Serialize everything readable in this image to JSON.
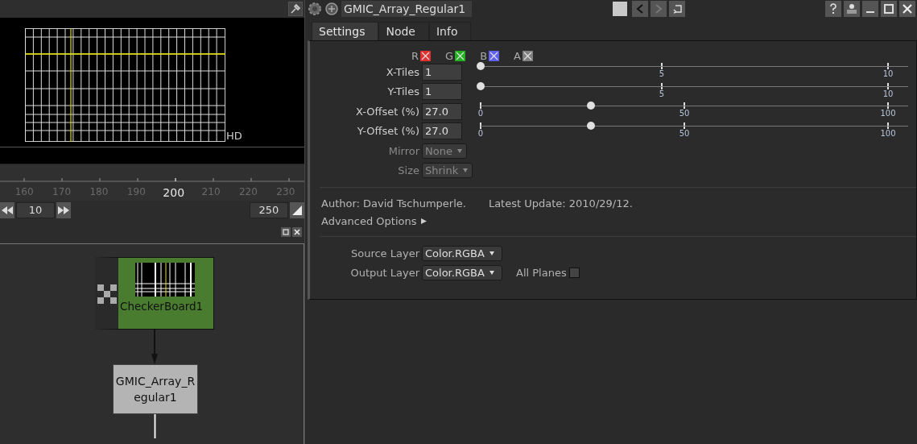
{
  "viewer": {
    "format_label": "HD"
  },
  "timeline": {
    "ticks": [
      {
        "label": "160",
        "current": false
      },
      {
        "label": "170",
        "current": false
      },
      {
        "label": "180",
        "current": false
      },
      {
        "label": "190",
        "current": false
      },
      {
        "label": "200",
        "current": true
      },
      {
        "label": "210",
        "current": false
      },
      {
        "label": "220",
        "current": false
      },
      {
        "label": "230",
        "current": false
      }
    ],
    "step": "10",
    "end_frame": "250"
  },
  "node_graph": {
    "nodes": [
      {
        "kind": "checkerboard",
        "lines": [
          "CheckerBoard1"
        ]
      },
      {
        "kind": "filter",
        "lines": [
          "GMIC_Array_R",
          "egular1"
        ]
      }
    ]
  },
  "properties": {
    "node_name": "GMIC_Array_Regular1",
    "tabs": [
      {
        "label": "Settings",
        "selected": true
      },
      {
        "label": "Node",
        "selected": false
      },
      {
        "label": "Info",
        "selected": false
      }
    ],
    "channels": [
      {
        "label": "R",
        "color": "#e03030",
        "checked": true
      },
      {
        "label": "G",
        "color": "#20b020",
        "checked": true
      },
      {
        "label": "B",
        "color": "#6060f0",
        "checked": true
      },
      {
        "label": "A",
        "color": "#808080",
        "checked": true
      }
    ],
    "params": [
      {
        "kind": "int-slider",
        "label": "X-Tiles",
        "value": "1",
        "level": 0,
        "ticks": [
          "5",
          "10"
        ]
      },
      {
        "kind": "int-slider",
        "label": "Y-Tiles",
        "value": "1",
        "level": 0,
        "ticks": [
          "5",
          "10"
        ]
      },
      {
        "kind": "float-slider",
        "label": "X-Offset (%)",
        "value": "27.0",
        "level": 0.27,
        "ticks": [
          "0",
          "50",
          "100"
        ]
      },
      {
        "kind": "float-slider",
        "label": "Y-Offset (%)",
        "value": "27.0",
        "level": 0.27,
        "ticks": [
          "0",
          "50",
          "100"
        ]
      },
      {
        "kind": "dropdown",
        "label": "Mirror",
        "value": "None",
        "disabled": true
      },
      {
        "kind": "dropdown",
        "label": "Size",
        "value": "Shrink",
        "disabled": true
      }
    ],
    "author": "Author: David Tschumperle.",
    "update": "Latest Update: 2010/29/12.",
    "advanced": "Advanced Options",
    "source_layer": {
      "label": "Source Layer",
      "value": "Color.RGBA"
    },
    "output_layer": {
      "label": "Output Layer",
      "value": "Color.RGBA"
    },
    "all_planes": {
      "label": "All Planes",
      "checked": false
    }
  }
}
